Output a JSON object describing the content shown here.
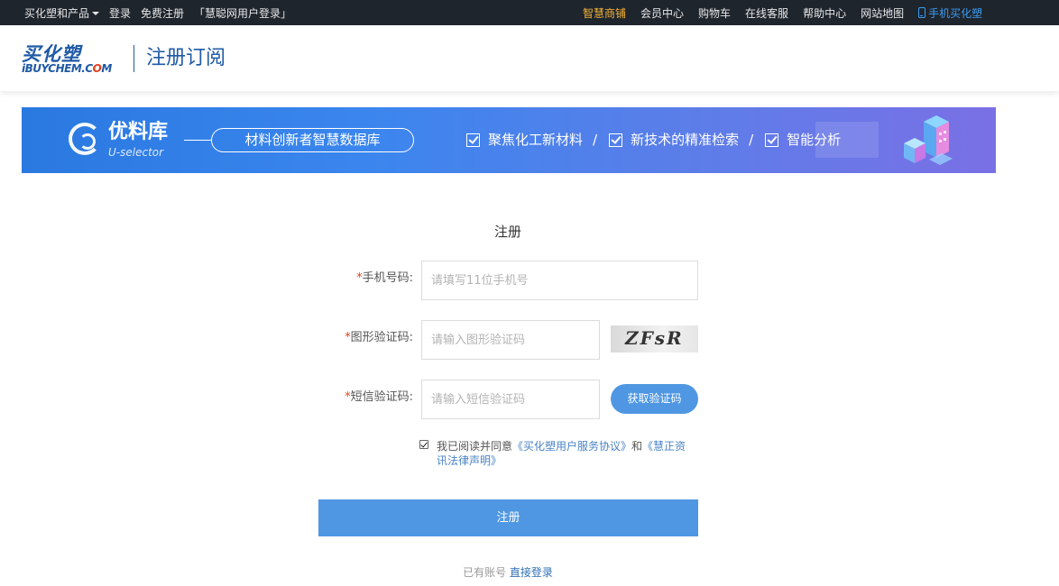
{
  "topbar": {
    "left": [
      {
        "label": "买化塑和产品"
      },
      {
        "label": "登录"
      },
      {
        "label": "免费注册"
      },
      {
        "label": "「慧聪网用户登录」"
      }
    ],
    "right": [
      {
        "label": "智慧商铺"
      },
      {
        "label": "会员中心"
      },
      {
        "label": "购物车"
      },
      {
        "label": "在线客服"
      },
      {
        "label": "帮助中心"
      },
      {
        "label": "网站地图"
      },
      {
        "label": "手机买化塑"
      }
    ]
  },
  "header": {
    "logo_cn": "买化塑",
    "logo_en_part1": "iBUYCHEM.C",
    "logo_en_o": "O",
    "logo_en_part2": "M",
    "title": "注册订阅"
  },
  "banner": {
    "brand": "优料库",
    "brand_en": "U-selector",
    "slogan": "材料创新者智慧数据库",
    "features": [
      "聚焦化工新材料",
      "新技术的精准检索",
      "智能分析"
    ],
    "separator": "/"
  },
  "form": {
    "title": "注册",
    "required_mark": "*",
    "phone": {
      "label": "手机号码:",
      "placeholder": "请填写11位手机号"
    },
    "captcha": {
      "label": "图形验证码:",
      "placeholder": "请输入图形验证码",
      "image_text": "ZFsR"
    },
    "sms": {
      "label": "短信验证码:",
      "placeholder": "请输入短信验证码",
      "button": "获取验证码"
    },
    "agreement": {
      "checked": true,
      "prefix": "我已阅读并同意",
      "link1": "《买化塑用户服务协议》",
      "conj": "和",
      "link2": "《慧正资讯法律声明》"
    },
    "submit": "注册",
    "login_prefix": "已有账号",
    "login_link": "直接登录"
  }
}
